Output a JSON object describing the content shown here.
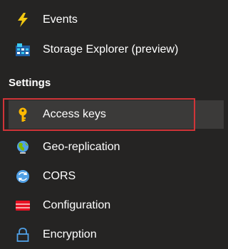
{
  "nav": {
    "events": {
      "label": "Events",
      "icon": "lightning-bolt-icon",
      "color": "#f2c811"
    },
    "storage_explorer": {
      "label": "Storage Explorer (preview)",
      "icon": "storage-explorer-icon",
      "color": "#3ccbf4"
    },
    "settings_header": "Settings",
    "access_keys": {
      "label": "Access keys",
      "icon": "key-icon",
      "color": "#ffb900",
      "selected": true
    },
    "geo_replication": {
      "label": "Geo-replication",
      "icon": "globe-icon",
      "color": "#7fba00"
    },
    "cors": {
      "label": "CORS",
      "icon": "cors-icon",
      "color": "#50a0e6"
    },
    "configuration": {
      "label": "Configuration",
      "icon": "configuration-icon",
      "color": "#e81123"
    },
    "encryption": {
      "label": "Encryption",
      "icon": "lock-icon",
      "color": "#50a0e6"
    }
  },
  "colors": {
    "background": "#252423",
    "selected_background": "#3b3a39",
    "highlight_border": "#d13438",
    "text": "#ffffff"
  }
}
